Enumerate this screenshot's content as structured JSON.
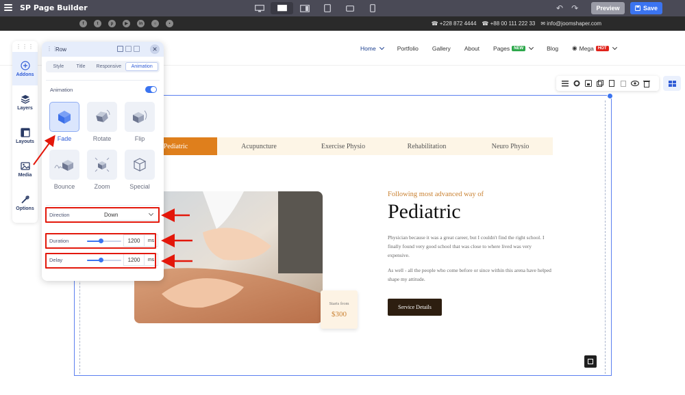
{
  "app": {
    "title": "SP Page Builder",
    "preview_label": "Preview",
    "save_label": "Save"
  },
  "site_top": {
    "contacts": [
      "+228 872 4444",
      "+88 00 111 222 33",
      "info@joomshaper.com"
    ]
  },
  "nav": {
    "items": [
      {
        "label": "Home",
        "active": true,
        "caret": true
      },
      {
        "label": "Portfolio"
      },
      {
        "label": "Gallery"
      },
      {
        "label": "About"
      },
      {
        "label": "Pages",
        "badge": "NEW",
        "badge_color": "#2ea84c",
        "caret": true
      },
      {
        "label": "Blog"
      },
      {
        "label": "Mega",
        "badge": "HOT",
        "badge_color": "#e0231b",
        "caret": true
      }
    ]
  },
  "sidebar": {
    "items": [
      {
        "label": "Addons",
        "icon": "plus-circle-icon",
        "active": true
      },
      {
        "label": "Layers",
        "icon": "layers-icon"
      },
      {
        "label": "Layouts",
        "icon": "layouts-icon"
      },
      {
        "label": "Media",
        "icon": "media-icon"
      },
      {
        "label": "Options",
        "icon": "options-icon"
      }
    ]
  },
  "panel": {
    "title": "Row",
    "tabs": [
      "Style",
      "Title",
      "Responsive",
      "Animation"
    ],
    "active_tab": "Animation",
    "animation_label": "Animation",
    "animation_enabled": true,
    "animations": [
      {
        "label": "Fade",
        "active": true
      },
      {
        "label": "Rotate"
      },
      {
        "label": "Flip"
      },
      {
        "label": "Bounce"
      },
      {
        "label": "Zoom"
      },
      {
        "label": "Special"
      }
    ],
    "direction": {
      "label": "Direction",
      "value": "Down"
    },
    "duration": {
      "label": "Duration",
      "value": "1200",
      "unit": "ms",
      "slider_fraction": 0.4
    },
    "delay": {
      "label": "Delay",
      "value": "1200",
      "unit": "ms",
      "slider_fraction": 0.4
    }
  },
  "content": {
    "categories": [
      "Pediatric",
      "Acupuncture",
      "Exercise Physio",
      "Rehabilitation",
      "Neuro Physio"
    ],
    "active_category": "Pediatric",
    "subheading": "Following most advanced way of",
    "heading": "Pediatric",
    "paragraph1": "Physician because it was a great career, but I couldn't find the right school. I finally found very good school that was close to where lived was very expensive.",
    "paragraph2": "As well - all the people who come before or since within this arena have helped shape my attitude.",
    "service_button": "Service Details",
    "price_from": "Starts from",
    "price_value": "$300"
  },
  "colors": {
    "accent": "#3b74f0",
    "orange": "#df7f1c",
    "annotation_red": "#e3170a"
  }
}
